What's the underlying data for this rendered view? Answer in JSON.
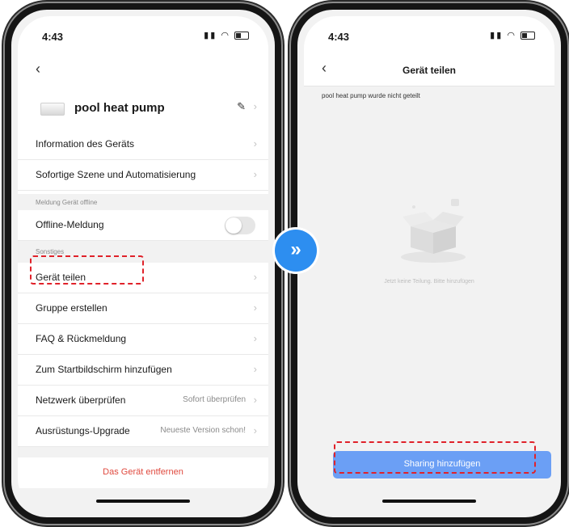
{
  "left_screen": {
    "time": "4:43",
    "device_name": "pool heat pump",
    "rows_top": [
      {
        "label": "Information des Geräts"
      },
      {
        "label": "Sofortige Szene und Automatisierung"
      }
    ],
    "section_offline": "Meldung Gerät offline",
    "offline_label": "Offline-Meldung",
    "section_other": "Sonstiges",
    "rows_other": [
      {
        "label": "Gerät teilen",
        "value": ""
      },
      {
        "label": "Gruppe erstellen",
        "value": ""
      },
      {
        "label": "FAQ & Rückmeldung",
        "value": ""
      },
      {
        "label": "Zum Startbildschirm hinzufügen",
        "value": ""
      },
      {
        "label": "Netzwerk überprüfen",
        "value": "Sofort überprüfen"
      },
      {
        "label": "Ausrüstungs-Upgrade",
        "value": "Neueste Version schon!"
      }
    ],
    "remove_label": "Das Gerät entfernen"
  },
  "right_screen": {
    "time": "4:43",
    "title": "Gerät teilen",
    "status_text": "pool heat pump wurde nicht geteilt",
    "empty_text": "Jetzt keine Teilung. Bitte hinzufügen",
    "add_button_label": "Sharing hinzufügen"
  },
  "colors": {
    "accent": "#2d8ef0",
    "highlight": "#e0222a",
    "danger": "#e04a3f",
    "button": "#6b9ff5"
  }
}
